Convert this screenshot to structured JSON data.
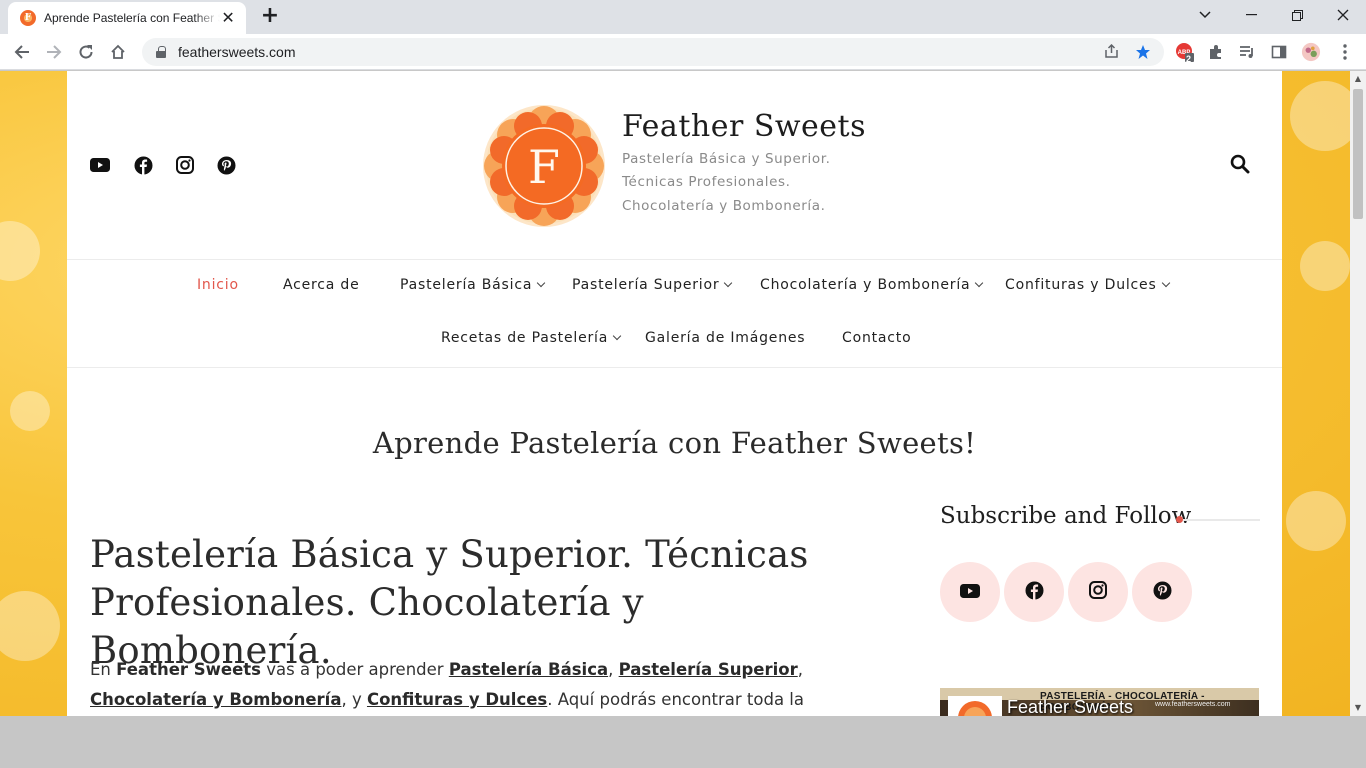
{
  "browser": {
    "tab_title": "Aprende Pastelería con Feather Sweets",
    "tab_close": "✕",
    "new_tab": "+",
    "url": "feathersweets.com",
    "extension_badge": "2"
  },
  "site": {
    "logo_letter": "F",
    "title": "Feather Sweets",
    "tagline": [
      "Pastelería Básica y Superior.",
      "Técnicas Profesionales.",
      "Chocolatería y Bombonería."
    ],
    "social_icons": [
      "youtube-icon",
      "facebook-icon",
      "instagram-icon",
      "pinterest-icon"
    ]
  },
  "nav": {
    "items": [
      {
        "label": "Inicio",
        "active": true,
        "has_dropdown": false
      },
      {
        "label": "Acerca de",
        "has_dropdown": false
      },
      {
        "label": "Pastelería Básica",
        "has_dropdown": true
      },
      {
        "label": "Pastelería Superior",
        "has_dropdown": true
      },
      {
        "label": "Chocolatería y Bombonería",
        "has_dropdown": true
      },
      {
        "label": "Confituras y Dulces",
        "has_dropdown": true
      },
      {
        "label": "Recetas de Pastelería",
        "has_dropdown": true
      },
      {
        "label": "Galería de Imágenes",
        "has_dropdown": false
      },
      {
        "label": "Contacto",
        "has_dropdown": false
      }
    ]
  },
  "hero": {
    "title": "Aprende Pastelería con Feather Sweets!"
  },
  "post": {
    "title_line1": "Pastelería Básica y Superior. Técnicas",
    "title_line2": "Profesionales. Chocolatería y Bombonería.",
    "body": {
      "t1": "En ",
      "brand": "Feather Sweets",
      "t2": " vas a poder aprender ",
      "link1": "Pastelería Básica",
      "t3": ", ",
      "link2": "Pastelería Superior",
      "t4": ", ",
      "link3": "Chocolatería y Bombonería",
      "t5": ", y ",
      "link4": "Confituras y Dulces",
      "t6": ". Aquí podrás encontrar toda la información para que puedas"
    }
  },
  "sidebar": {
    "widget_title": "Subscribe and Follow",
    "banner_header": "PASTELERÍA - CHOCOLATERÍA - BOMBONERÍA",
    "banner_url": "www.feathersweets.com",
    "banner_title": "Feather Sweets"
  },
  "colors": {
    "accent": "#e2574c",
    "background": "#f8c53a",
    "subscribe_circle": "#fde4e2"
  }
}
